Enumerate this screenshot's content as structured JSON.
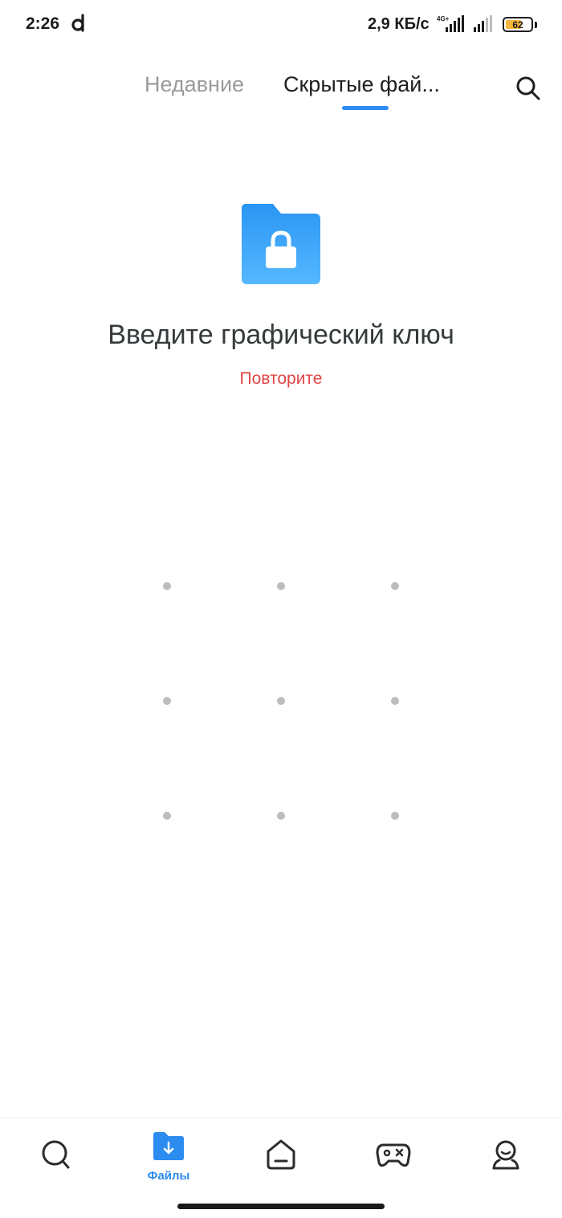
{
  "status_bar": {
    "time": "2:26",
    "network_speed": "2,9 КБ/с",
    "network_type": "4G+",
    "battery_level": "62",
    "battery_color": "#f4b63c"
  },
  "tabs": [
    {
      "label": "Недавние",
      "active": false
    },
    {
      "label": "Скрытые фай...",
      "active": true
    }
  ],
  "accent_color": "#2d8cf0",
  "lock_screen": {
    "icon": "locked-folder-icon",
    "title": "Введите графический ключ",
    "hint": "Повторите",
    "hint_color": "#e04545",
    "pattern": {
      "rows": 3,
      "cols": 3
    }
  },
  "bottom_nav": [
    {
      "icon": "search-icon",
      "label": ""
    },
    {
      "icon": "files-icon",
      "label": "Файлы",
      "active": true
    },
    {
      "icon": "device-icon",
      "label": ""
    },
    {
      "icon": "games-icon",
      "label": ""
    },
    {
      "icon": "profile-icon",
      "label": ""
    }
  ]
}
